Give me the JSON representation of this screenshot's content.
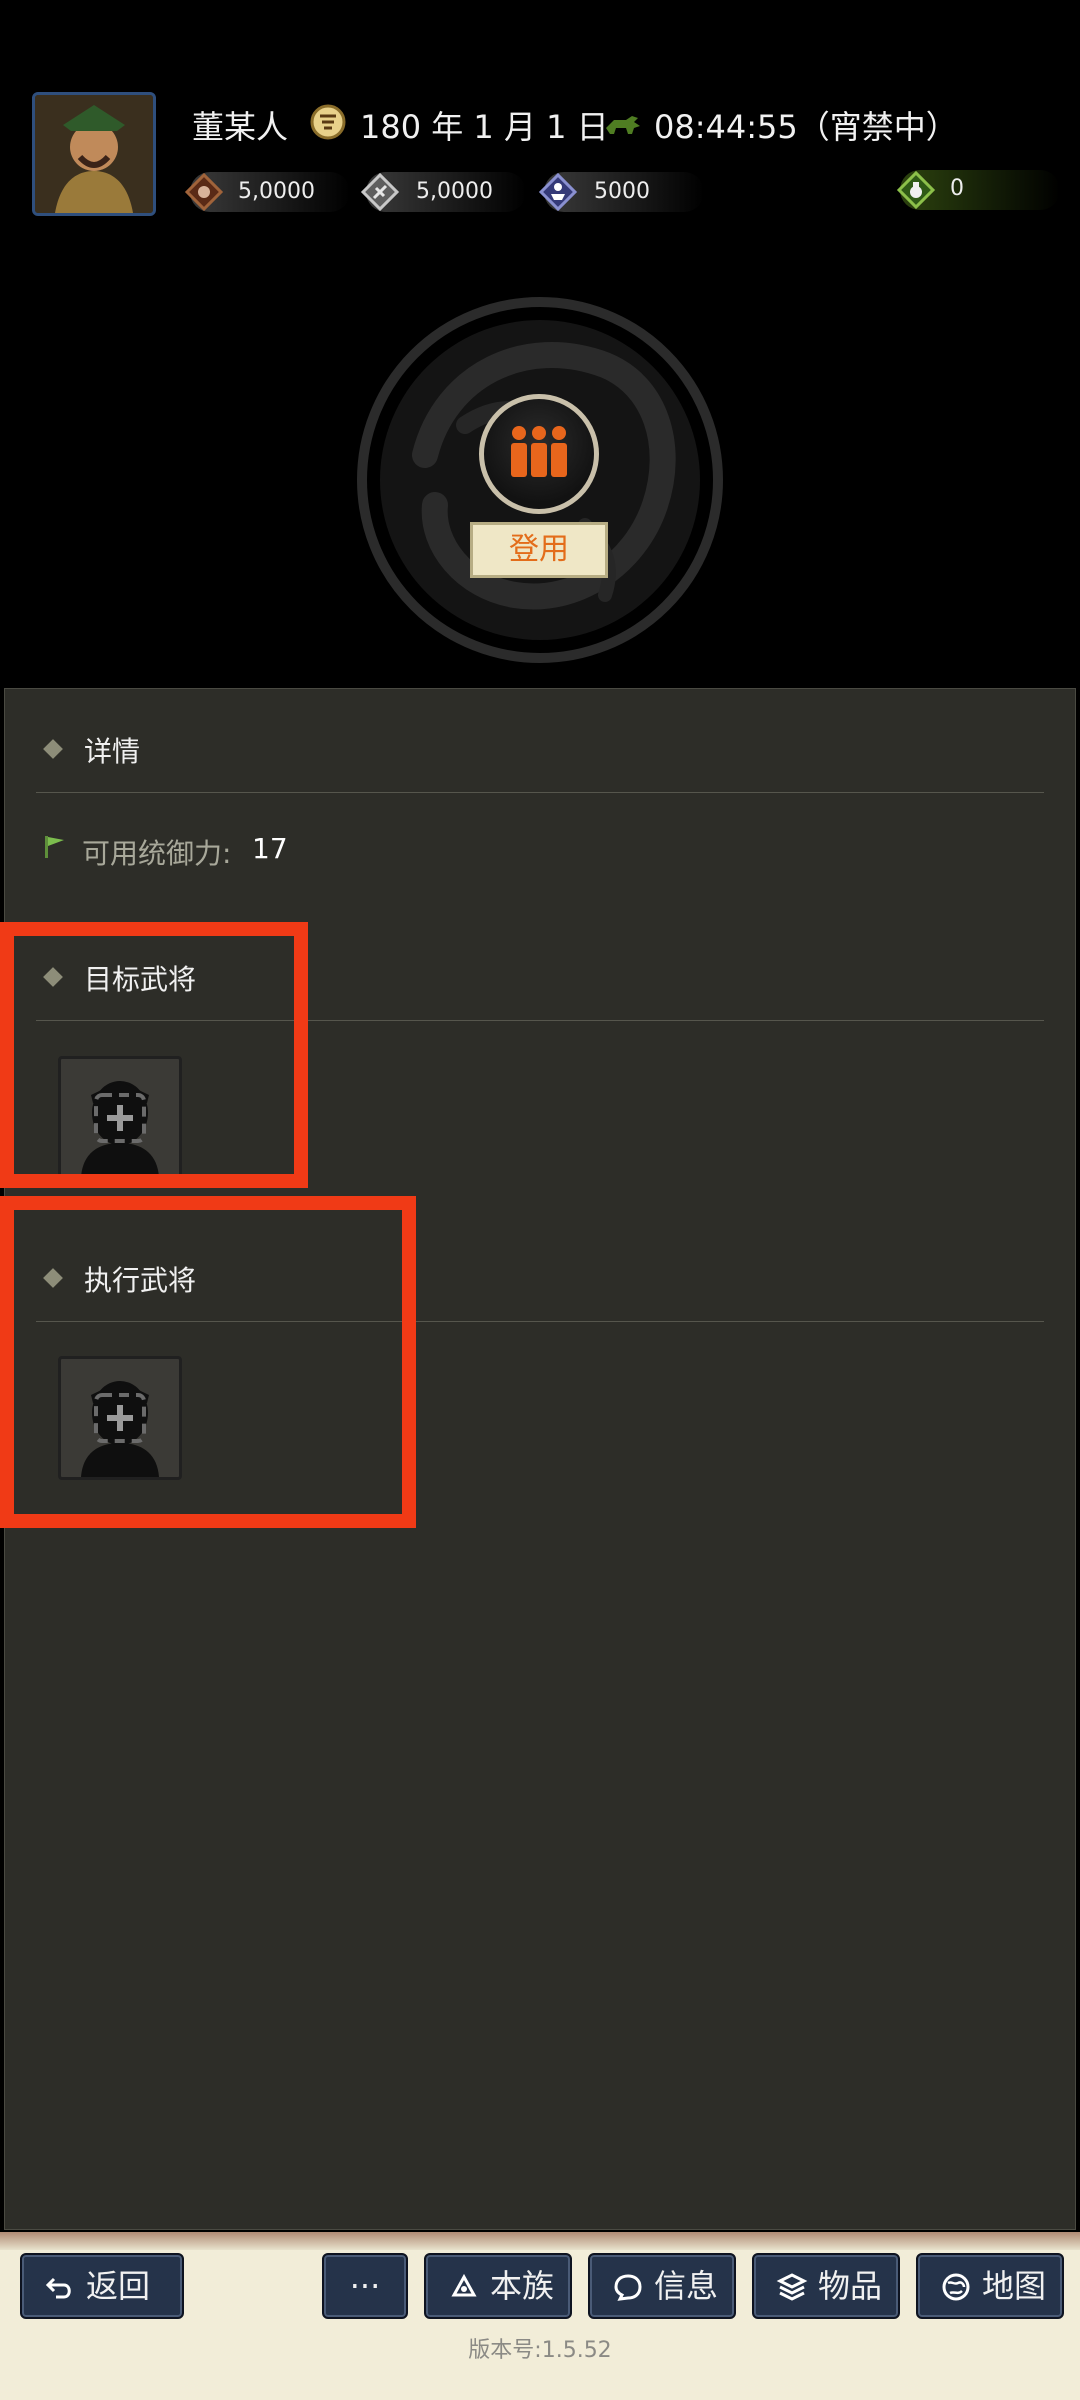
{
  "header": {
    "player_name": "董某人",
    "date": "180 年 1 月 1 日",
    "time": "08:44:55（宵禁中）",
    "resources": [
      {
        "name": "money",
        "icon": "coin-bag-icon",
        "value": "5,0000",
        "color": "#6b3b26"
      },
      {
        "name": "grain",
        "icon": "grain-icon",
        "value": "5,0000",
        "color": "#6e6e6e"
      },
      {
        "name": "troops",
        "icon": "soldier-icon",
        "value": "5000",
        "color": "#3b3f7c"
      },
      {
        "name": "items",
        "icon": "pouch-icon",
        "value": "0",
        "color": "#3f6a1f"
      }
    ]
  },
  "emblem": {
    "button_icon": "three-people-icon",
    "label": "登用"
  },
  "panel": {
    "details": {
      "title": "详情",
      "stat_label": "可用统御力:",
      "stat_value": "17"
    },
    "target": {
      "title": "目标武将",
      "slot_icon": "add-person-icon"
    },
    "executor": {
      "title": "执行武将",
      "slot_icon": "add-person-icon"
    }
  },
  "bottom_nav": {
    "back": "返回",
    "more": "···",
    "clan": "本族",
    "info": "信息",
    "items": "物品",
    "map": "地图"
  },
  "version": "版本号:1.5.52",
  "colors": {
    "panel_bg": "#2d2d28",
    "highlight_red": "#f03a16",
    "accent_orange": "#e36d1a",
    "nav_blue": "#25334a"
  }
}
